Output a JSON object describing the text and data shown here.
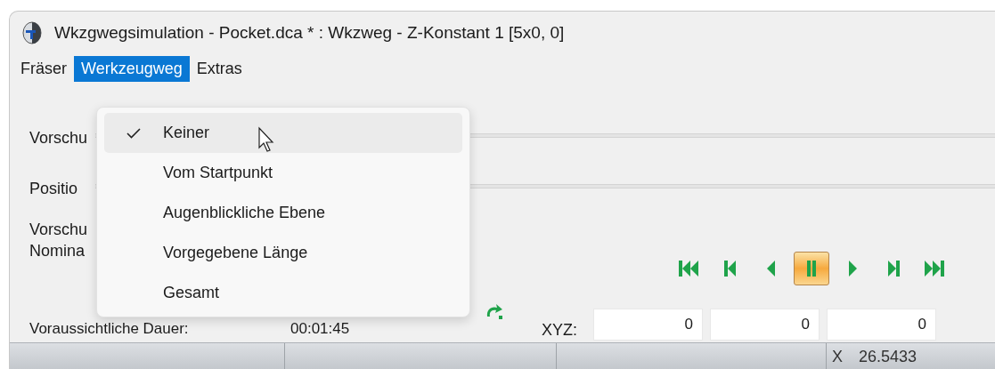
{
  "window": {
    "title": "Wkzgwegsimulation - Pocket.dca * : Wkzweg - Z-Konstant 1 [5x0, 0]"
  },
  "menu_bar": [
    {
      "label": "Fräser",
      "selected": false
    },
    {
      "label": "Werkzeugweg",
      "selected": true
    },
    {
      "label": "Extras",
      "selected": false
    }
  ],
  "dropdown": [
    {
      "label": "Keiner",
      "checked": true,
      "hovered": true
    },
    {
      "label": "Vom Startpunkt",
      "checked": false,
      "hovered": false
    },
    {
      "label": "Augenblickliche Ebene",
      "checked": false,
      "hovered": false
    },
    {
      "label": "Vorgegebene Länge",
      "checked": false,
      "hovered": false
    },
    {
      "label": "Gesamt",
      "checked": false,
      "hovered": false
    }
  ],
  "form_labels": [
    "Vorschu",
    "Positio",
    "Vorschu",
    "Nomina"
  ],
  "duration": {
    "label": "Voraussichtliche Dauer:",
    "value": "00:01:45"
  },
  "playback": [
    {
      "kind": "first",
      "selected": false
    },
    {
      "kind": "prev",
      "selected": false
    },
    {
      "kind": "back",
      "selected": false
    },
    {
      "kind": "pause",
      "selected": true
    },
    {
      "kind": "play",
      "selected": false
    },
    {
      "kind": "next",
      "selected": false
    },
    {
      "kind": "last",
      "selected": false
    }
  ],
  "xyz": {
    "label": "XYZ:",
    "values": [
      "0",
      "0",
      "0"
    ]
  },
  "status_bar": {
    "axis": "X",
    "value": "26.5433"
  }
}
